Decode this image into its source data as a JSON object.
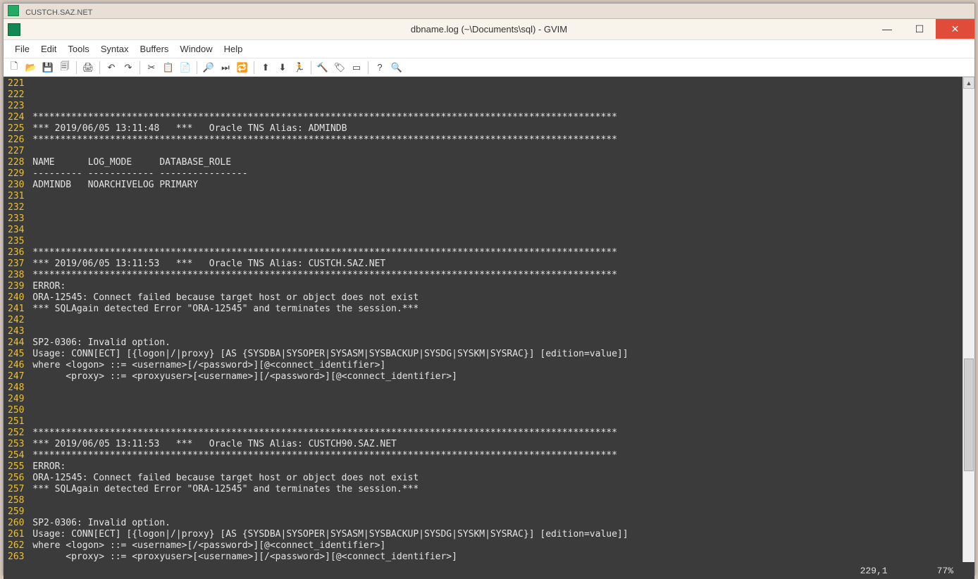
{
  "window": {
    "tab_name": "CUSTCH.SAZ.NET",
    "title": "dbname.log (~\\Documents\\sql) - GVIM"
  },
  "menubar": [
    "File",
    "Edit",
    "Tools",
    "Syntax",
    "Buffers",
    "Window",
    "Help"
  ],
  "toolbar_icons": [
    {
      "n": "new-icon",
      "g": "🗋"
    },
    {
      "n": "open-icon",
      "g": "📂"
    },
    {
      "n": "save-icon",
      "g": "💾"
    },
    {
      "n": "saveall-icon",
      "g": "🗐"
    },
    {
      "n": "sep"
    },
    {
      "n": "print-icon",
      "g": "🖨"
    },
    {
      "n": "sep"
    },
    {
      "n": "undo-icon",
      "g": "↶"
    },
    {
      "n": "redo-icon",
      "g": "↷"
    },
    {
      "n": "sep"
    },
    {
      "n": "cut-icon",
      "g": "✂"
    },
    {
      "n": "copy-icon",
      "g": "📋"
    },
    {
      "n": "paste-icon",
      "g": "📄"
    },
    {
      "n": "sep"
    },
    {
      "n": "find-icon",
      "g": "🔎"
    },
    {
      "n": "findnext-icon",
      "g": "⏭"
    },
    {
      "n": "replace-icon",
      "g": "🔁"
    },
    {
      "n": "sep"
    },
    {
      "n": "load-icon",
      "g": "⬆"
    },
    {
      "n": "save-session-icon",
      "g": "⬇"
    },
    {
      "n": "run-icon",
      "g": "🏃"
    },
    {
      "n": "sep"
    },
    {
      "n": "make-icon",
      "g": "🔨"
    },
    {
      "n": "tag-icon",
      "g": "🏷"
    },
    {
      "n": "shell-icon",
      "g": "▭"
    },
    {
      "n": "sep"
    },
    {
      "n": "help-icon",
      "g": "?"
    },
    {
      "n": "findhelp-icon",
      "g": "🔍"
    }
  ],
  "first_line": 221,
  "lines": [
    "",
    "",
    "",
    " **********************************************************************************************************",
    " *** 2019/06/05 13:11:48   ***   Oracle TNS Alias: ADMINDB",
    " **********************************************************************************************************",
    "",
    " NAME      LOG_MODE     DATABASE_ROLE",
    " --------- ------------ ----------------",
    " ADMINDB   NOARCHIVELOG PRIMARY",
    "",
    "",
    "",
    "",
    "",
    " **********************************************************************************************************",
    " *** 2019/06/05 13:11:53   ***   Oracle TNS Alias: CUSTCH.SAZ.NET",
    " **********************************************************************************************************",
    " ERROR:",
    " ORA-12545: Connect failed because target host or object does not exist",
    " *** SQLAgain detected Error \"ORA-12545\" and terminates the session.***",
    "",
    "",
    " SP2-0306: Invalid option.",
    " Usage: CONN[ECT] [{logon|/|proxy} [AS {SYSDBA|SYSOPER|SYSASM|SYSBACKUP|SYSDG|SYSKM|SYSRAC}] [edition=value]]",
    " where <logon> ::= <username>[/<password>][@<connect_identifier>]",
    "       <proxy> ::= <proxyuser>[<username>][/<password>][@<connect_identifier>]",
    "",
    "",
    "",
    "",
    " **********************************************************************************************************",
    " *** 2019/06/05 13:11:53   ***   Oracle TNS Alias: CUSTCH90.SAZ.NET",
    " **********************************************************************************************************",
    " ERROR:",
    " ORA-12545: Connect failed because target host or object does not exist",
    " *** SQLAgain detected Error \"ORA-12545\" and terminates the session.***",
    "",
    "",
    " SP2-0306: Invalid option.",
    " Usage: CONN[ECT] [{logon|/|proxy} [AS {SYSDBA|SYSOPER|SYSASM|SYSBACKUP|SYSDG|SYSKM|SYSRAC}] [edition=value]]",
    " where <logon> ::= <username>[/<password>][@<connect_identifier>]",
    "       <proxy> ::= <proxyuser>[<username>][/<password>][@<connect_identifier>]",
    ""
  ],
  "status": {
    "position": "229,1",
    "percent": "77%"
  }
}
